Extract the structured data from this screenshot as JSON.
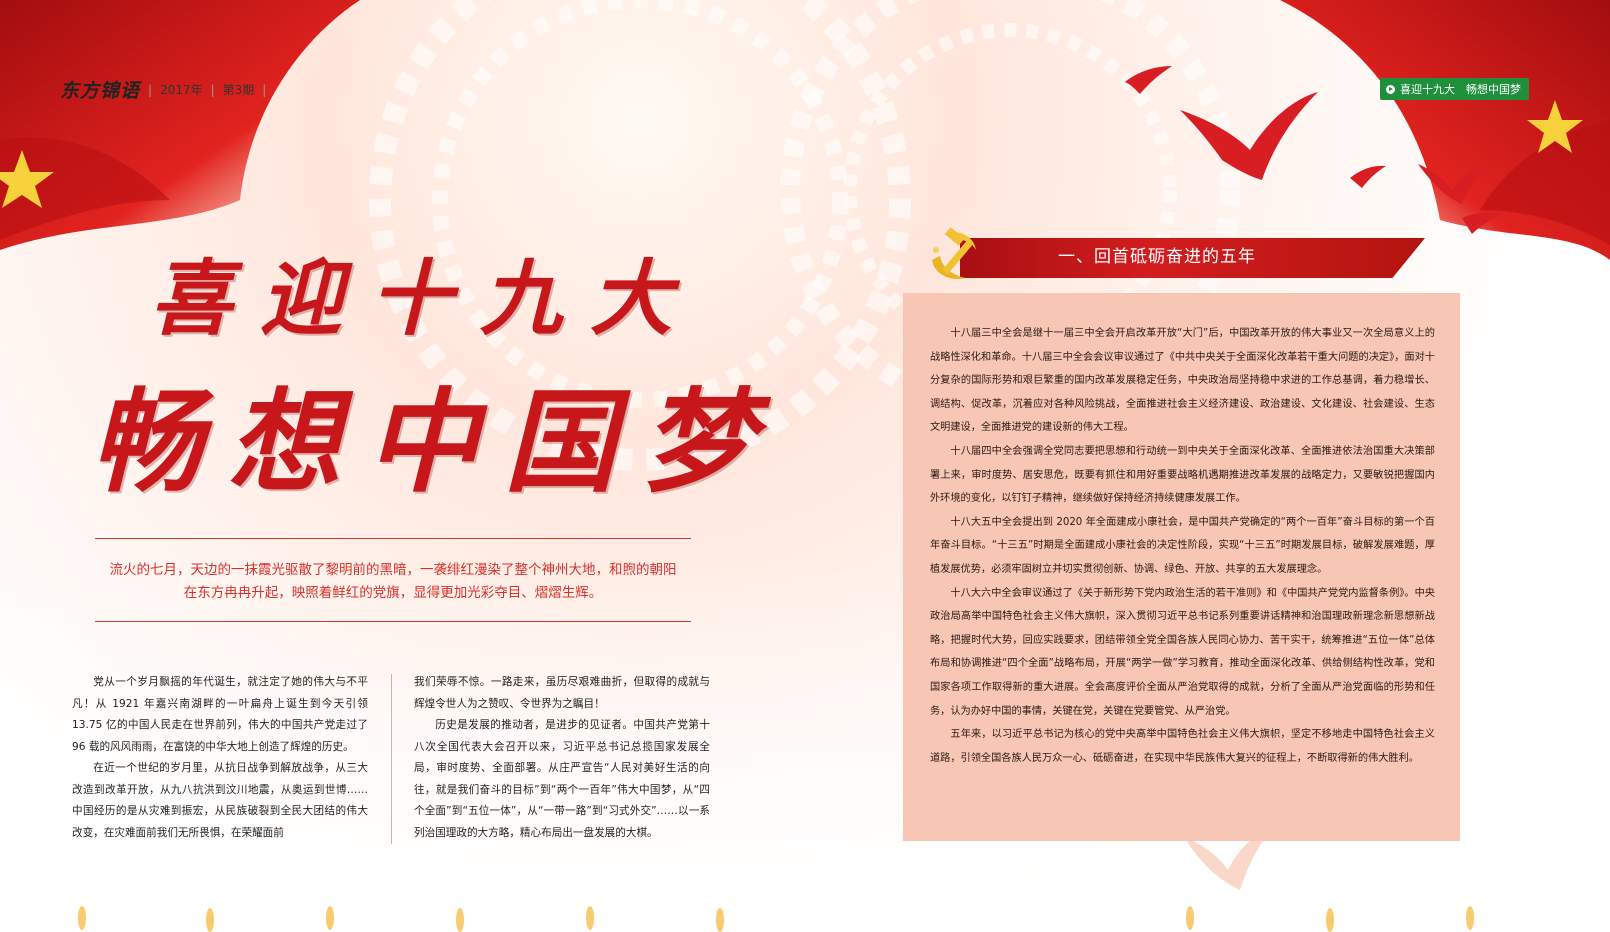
{
  "masthead": {
    "logo": "东方锦语",
    "year": "2017年",
    "issue": "第3期"
  },
  "section_tag": "喜迎十九大　畅想中国梦",
  "title": {
    "line1": "喜迎十九大",
    "line2": "畅想中国梦"
  },
  "intro": {
    "line1": "流火的七月，天边的一抹霞光驱散了黎明前的黑暗，一袭绯红漫染了整个神州大地，和煦的朝阳",
    "line2": "在东方冉冉升起，映照着鲜红的党旗，显得更加光彩夺目、熠熠生辉。"
  },
  "left_column": {
    "p1": "党从一个岁月飘摇的年代诞生，就注定了她的伟大与不平凡！从 1921 年嘉兴南湖畔的一叶扁舟上诞生到今天引领 13.75 亿的中国人民走在世界前列，伟大的中国共产党走过了 96 载的风风雨雨，在富饶的中华大地上创造了辉煌的历史。",
    "p2": "在近一个世纪的岁月里，从抗日战争到解放战争，从三大改造到改革开放，从九八抗洪到汶川地震，从奥运到世博……中国经历的是从灾难到振宏，从民族破裂到全民大团结的伟大改变，在灾难面前我们无所畏惧，在荣耀面前"
  },
  "right_column": {
    "p1": "我们荣辱不惊。一路走来，虽历尽艰难曲折，但取得的成就与辉煌令世人为之赞叹、令世界为之瞩目！",
    "p2": "历史是发展的推动者，是进步的见证者。中国共产党第十八次全国代表大会召开以来，习近平总书记总揽国家发展全局，审时度势、全面部署。从庄严宣告“人民对美好生活的向往，就是我们奋斗的目标”到“两个一百年”伟大中国梦，从“四个全面”到“五位一体”，从“一带一路”到“习式外交”……以一系列治国理政的大方略，精心布局出一盘发展的大棋。"
  },
  "section_header": "一、回首砥砺奋进的五年",
  "box": {
    "p1": "十八届三中全会是继十一届三中全会开启改革开放“大门”后，中国改革开放的伟大事业又一次全局意义上的战略性深化和革命。十八届三中全会会议审议通过了《中共中央关于全面深化改革若干重大问题的决定》，面对十分复杂的国际形势和艰巨繁重的国内改革发展稳定任务，中央政治局坚持稳中求进的工作总基调，着力稳增长、调结构、促改革，沉着应对各种风险挑战，全面推进社会主义经济建设、政治建设、文化建设、社会建设、生态文明建设，全面推进党的建设新的伟大工程。",
    "p2": "十八届四中全会强调全党同志要把思想和行动统一到中央关于全面深化改革、全面推进依法治国重大决策部署上来，审时度势、居安思危，既要有抓住和用好重要战略机遇期推进改革发展的战略定力，又要敏锐把握国内外环境的变化，以钉钉子精神，继续做好保持经济持续健康发展工作。",
    "p3": "十八大五中全会提出到 2020 年全面建成小康社会，是中国共产党确定的“两个一百年”奋斗目标的第一个百年奋斗目标。“十三五”时期是全面建成小康社会的决定性阶段，实现“十三五”时期发展目标，破解发展难题，厚植发展优势，必须牢固树立并切实贯彻创新、协调、绿色、开放、共享的五大发展理念。",
    "p4": "十八大六中全会审议通过了《关于新形势下党内政治生活的若干准则》和《中国共产党党内监督条例》。中央政治局高举中国特色社会主义伟大旗帜，深入贯彻习近平总书记系列重要讲话精神和治国理政新理念新思想新战略，把握时代大势，回应实践要求，团结带领全党全国各族人民同心协力、苦干实干，统筹推进“五位一体”总体布局和协调推进“四个全面”战略布局，开展“两学一做”学习教育，推动全面深化改革、供给侧结构性改革，党和国家各项工作取得新的重大进展。全会高度评价全面从严治党取得的成就，分析了全面从严治党面临的形势和任务，认为办好中国的事情，关键在党，关键在党要管党、从严治党。",
    "p5": "五年来，以习近平总书记为核心的党中央高举中国特色社会主义伟大旗帜，坚定不移地走中国特色社会主义道路，引领全国各族人民万众一心、砥砺奋进，在实现中华民族伟大复兴的征程上，不断取得新的伟大胜利。"
  },
  "colors": {
    "red": "#c8171b",
    "box": "#f8c6b4",
    "tag_green": "#1f8f3b"
  },
  "icons": [
    "party-emblem-icon",
    "dove-icon",
    "flag-icon",
    "play-icon"
  ]
}
